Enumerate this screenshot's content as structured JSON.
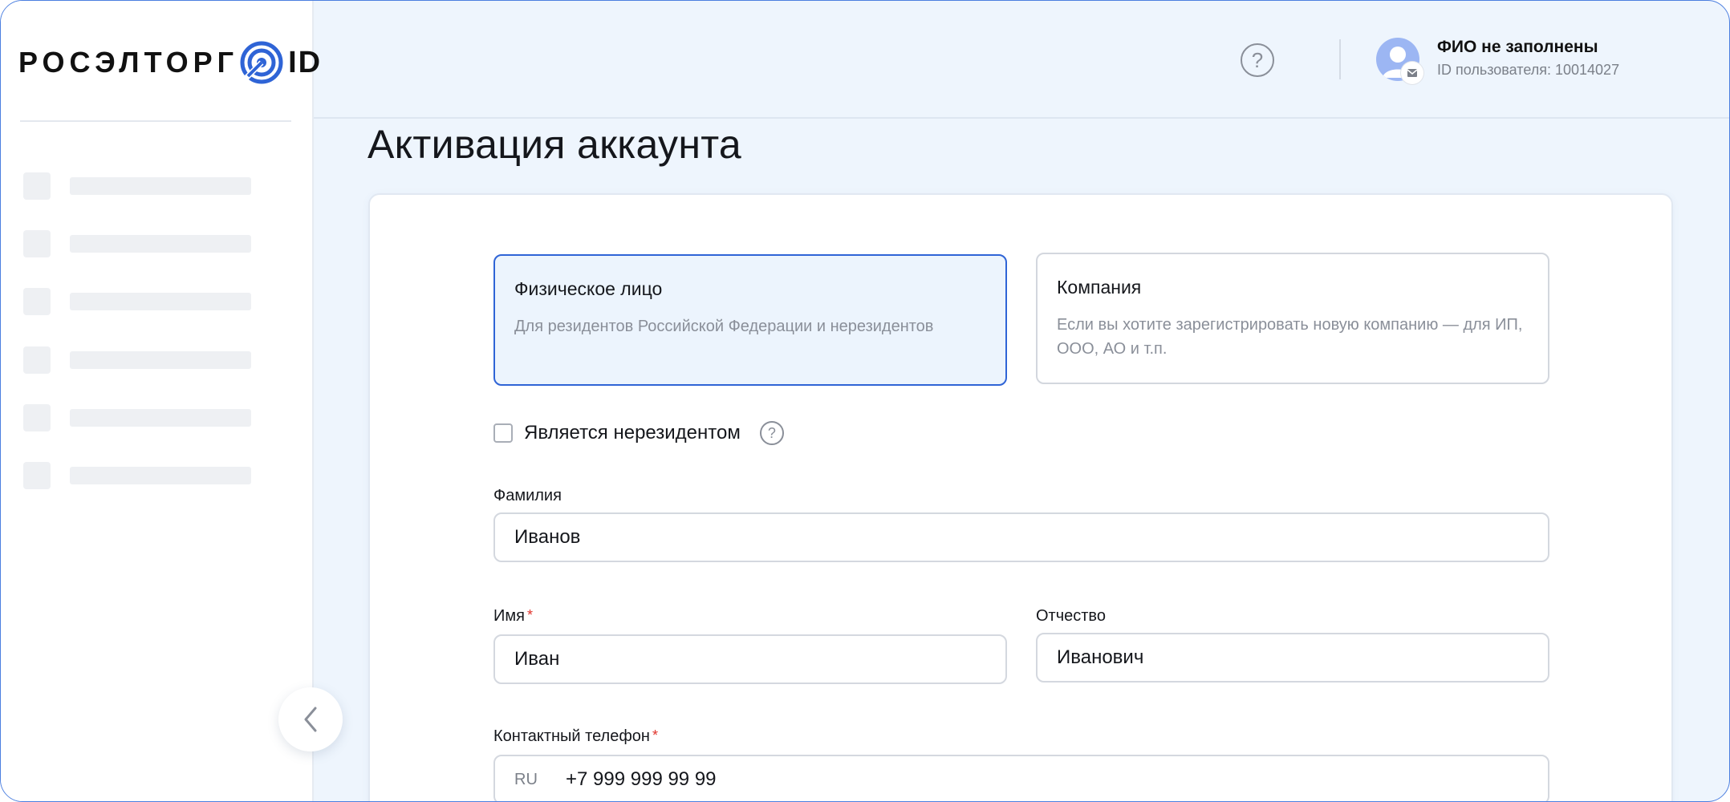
{
  "brand": {
    "logo_text": "РОСЭЛТОРГ",
    "logo_suffix": "ID"
  },
  "header": {
    "user_name": "ФИО не заполнены",
    "user_id": "ID пользователя: 10014027",
    "help_glyph": "?"
  },
  "page": {
    "title": "Активация аккаунта"
  },
  "account_types": [
    {
      "title": "Физическое лицо",
      "description": "Для резидентов Российской Федерации и нерезидентов",
      "selected": true
    },
    {
      "title": "Компания",
      "description": "Если вы хотите зарегистрировать новую компанию — для ИП, ООО, АО и т.п.",
      "selected": false
    }
  ],
  "nonresident": {
    "label": "Является нерезидентом",
    "checked": false,
    "help_glyph": "?"
  },
  "form": {
    "surname": {
      "label": "Фамилия",
      "value": "Иванов"
    },
    "name": {
      "label": "Имя",
      "required_mark": "*",
      "value": "Иван"
    },
    "patronymic": {
      "label": "Отчество",
      "value": "Иванович"
    },
    "phone": {
      "label": "Контактный телефон",
      "required_mark": "*",
      "country": "RU",
      "value": "+7 999 999 99 99"
    }
  },
  "colors": {
    "accent": "#2f64d6",
    "selected_bg": "#ecf4fd",
    "page_bg": "#eef5fd",
    "required": "#e0342c"
  },
  "icons": [
    "logo-mark-icon",
    "help-icon",
    "avatar-icon",
    "mail-icon",
    "chevron-left-icon",
    "question-icon"
  ]
}
